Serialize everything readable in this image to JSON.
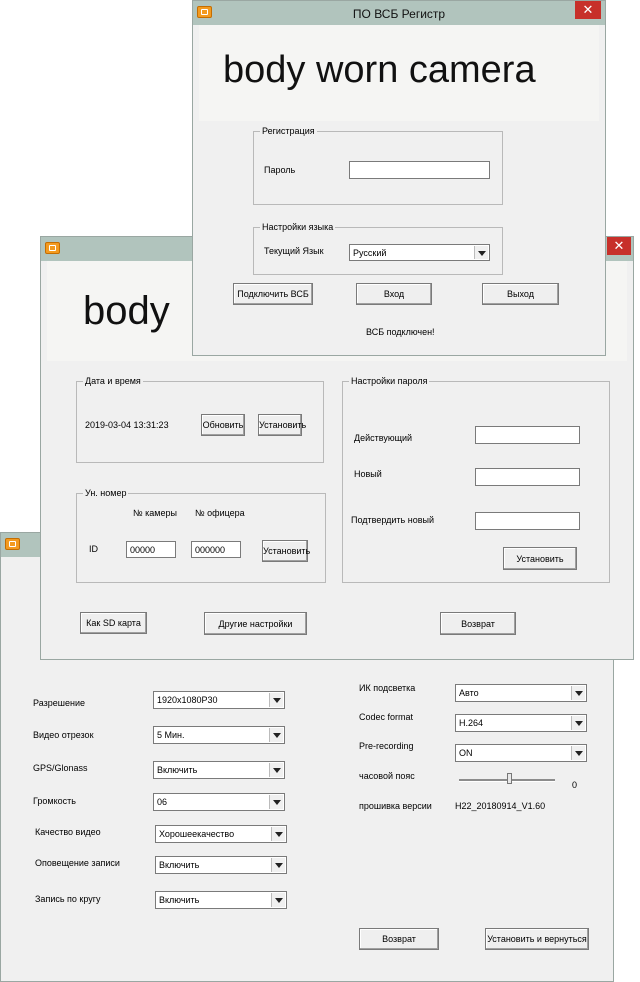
{
  "settings": {
    "labels": {
      "resolution": "Разрешение",
      "segment": "Видео отрезок",
      "gps": "GPS/Glonass",
      "volume": "Громкость",
      "quality": "Качество видео",
      "rec_notify": "Оповещение записи",
      "loop": "Запись по кругу",
      "ir": "ИК подсветка",
      "codec": "Codec format",
      "prerec": "Pre-recording",
      "tz": "часовой пояс",
      "firmware": "прошивка версии"
    },
    "values": {
      "resolution": "1920x1080P30",
      "segment": "5 Мин.",
      "gps": "Включить",
      "volume": "06",
      "quality": "Хорошеекачество",
      "rec_notify": "Включить",
      "loop": "Включить",
      "ir": "Авто",
      "codec": "H.264",
      "prerec": "ON",
      "tz": "0",
      "firmware": "H22_20180914_V1.60"
    },
    "back_label": "Возврат",
    "apply_back_label": "Установить и вернуться"
  },
  "main": {
    "banner_text": "body",
    "datetime": {
      "legend": "Дата и время",
      "value": "2019-03-04 13:31:23",
      "refresh_label": "Обновить",
      "set_label": "Установить"
    },
    "ids": {
      "legend": "Ун. номер",
      "camera_header": "№ камеры",
      "officer_header": "№ офицера",
      "id_label": "ID",
      "camera_value": "00000",
      "officer_value": "000000",
      "set_label": "Установить"
    },
    "password": {
      "legend": "Настройки пароля",
      "current_label": "Действующий",
      "new_label": "Новый",
      "confirm_label": "Подтвердить новый",
      "set_label": "Установить"
    },
    "sd_label": "Как SD карта",
    "other_label": "Другие настройки",
    "back_label": "Возврат"
  },
  "login": {
    "title": "ПО ВСБ Регистр",
    "close_symbol": "✕",
    "banner_text": "body worn camera",
    "registration_legend": "Регистрация",
    "password_label": "Пароль",
    "password_value": "",
    "language_legend": "Настройки языка",
    "current_language_label": "Текущий Язык",
    "current_language_value": "Русский",
    "connect_label": "Подключить ВСБ",
    "login_label": "Вход",
    "exit_label": "Выход",
    "status_text": "ВСБ подключен!"
  },
  "colors": {
    "titlebar": "#b1c4bd",
    "close": "#c7302a",
    "window_bg": "#f0f0f0",
    "app_icon": "#f39a1f"
  }
}
